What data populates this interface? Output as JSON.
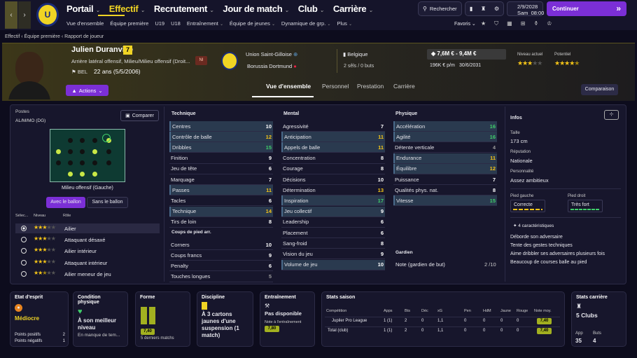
{
  "nav": {
    "items": [
      "Portail",
      "Effectif",
      "Recrutement",
      "Jour de match",
      "Club",
      "Carrière"
    ],
    "active": "Effectif",
    "subitems": [
      "Vue d'ensemble",
      "Équipe première",
      "U19",
      "U18",
      "Entraînement",
      "Équipe de jeunes",
      "Dynamique de grp.",
      "Plus"
    ],
    "search": "Rechercher",
    "date": "2/9/2028",
    "day_time": "Sam  08:00",
    "continue": "Continuer",
    "favoris": "Favoris"
  },
  "breadcrumb": [
    "Effectif",
    "Équipe première",
    "Rapport de joueur"
  ],
  "player": {
    "name": "Julien Duranville",
    "number": "7",
    "role": "Arrière latéral offensif, Milieu/Milieu offensif (Droit...",
    "nationality": "BEL",
    "age": "22 ans (5/5/2006)",
    "nl": "NI",
    "club": "Union Saint-Gilloise",
    "loan_club": "Borussia Dortmund",
    "country": "Belgique",
    "stats": "2 sêls / 0 buts",
    "value": "7,6M € - 9,4M €",
    "wage": "196K € p/m",
    "contract": "30/6/2031",
    "actions": "Actions",
    "current_label": "Niveau actuel",
    "potential_label": "Potentiel",
    "current_stars": 3,
    "potential_stars": 4.5
  },
  "tabs": [
    "Vue d'ensemble",
    "Personnel",
    "Prestation",
    "Carrière"
  ],
  "compare_btn": "Comparaison",
  "positions": {
    "title": "Postes",
    "value": "AL/M/MO (DG)",
    "compare": "Comparer",
    "caption": "Milieu offensif (Gauche)",
    "toggle": [
      "Avec le ballon",
      "Sans le ballon"
    ],
    "headers": [
      "Sélec...",
      "Niveau",
      "Rôle"
    ],
    "roles": [
      {
        "name": "Ailier",
        "stars": 3,
        "selected": true
      },
      {
        "name": "Attaquant désaxé",
        "stars": 3
      },
      {
        "name": "Ailier intérieur",
        "stars": 3
      },
      {
        "name": "Attaquant intérieur",
        "stars": 3
      },
      {
        "name": "Ailier meneur de jeu",
        "stars": 2.5
      }
    ]
  },
  "technique": {
    "title": "Technique",
    "rows": [
      [
        "Centres",
        "10"
      ],
      [
        "Contrôle de balle",
        "12"
      ],
      [
        "Dribbles",
        "15"
      ],
      [
        "Finition",
        "9"
      ],
      [
        "Jeu de tête",
        "6"
      ],
      [
        "Marquage",
        "7"
      ],
      [
        "Passes",
        "11"
      ],
      [
        "Tacles",
        "6"
      ],
      [
        "Technique",
        "14"
      ],
      [
        "Tirs de loin",
        "8"
      ]
    ],
    "set_title": "Coups de pied arr.",
    "set_rows": [
      [
        "Corners",
        "10"
      ],
      [
        "Coups francs",
        "9"
      ],
      [
        "Penalty",
        "6"
      ],
      [
        "Touches longues",
        "5"
      ]
    ]
  },
  "mental": {
    "title": "Mental",
    "rows": [
      [
        "Agressivité",
        "7"
      ],
      [
        "Anticipation",
        "11"
      ],
      [
        "Appels de balle",
        "11"
      ],
      [
        "Concentration",
        "8"
      ],
      [
        "Courage",
        "8"
      ],
      [
        "Décisions",
        "10"
      ],
      [
        "Détermination",
        "13"
      ],
      [
        "Inspiration",
        "17"
      ],
      [
        "Jeu collectif",
        "9"
      ],
      [
        "Leadership",
        "6"
      ],
      [
        "Placement",
        "6"
      ],
      [
        "Sang-froid",
        "8"
      ],
      [
        "Vision du jeu",
        "9"
      ],
      [
        "Volume de jeu",
        "10"
      ]
    ]
  },
  "physique": {
    "title": "Physique",
    "rows": [
      [
        "Accélération",
        "16"
      ],
      [
        "Agilité",
        "16"
      ],
      [
        "Détente verticale",
        "4"
      ],
      [
        "Endurance",
        "11"
      ],
      [
        "Équilibre",
        "12"
      ],
      [
        "Puissance",
        "7"
      ],
      [
        "Qualités phys. nat.",
        "8"
      ],
      [
        "Vitesse",
        "15"
      ]
    ],
    "gk_title": "Gardien",
    "gk_row": [
      "Note (gardien de but)",
      "2 /10"
    ]
  },
  "info": {
    "title": "Infos",
    "height_label": "Taille",
    "height": "173 cm",
    "rep_label": "Réputation",
    "rep": "Nationale",
    "pers_label": "Personnalité",
    "pers": "Assez ambitieux",
    "lf_label": "Pied gauche",
    "lf": "Correcte",
    "rf_label": "Pied droit",
    "rf": "Très fort",
    "traits_title": "4 caractéristiques",
    "traits": [
      "Déborde son adversaire",
      "Tente des gestes techniques",
      "Aime dribbler ses adversaires plusieurs fois",
      "Beaucoup de courses balle au pied"
    ]
  },
  "cards": {
    "esprit": {
      "title": "Etat d'esprit",
      "value": "Médiocre",
      "rows": [
        [
          "Points positifs",
          "2"
        ],
        [
          "Points négatifs",
          "1"
        ]
      ]
    },
    "condition": {
      "title": "Condition physique",
      "value": "À son meilleur niveau",
      "sub": "En manque de tem..."
    },
    "forme": {
      "title": "Forme",
      "rating": "7,40",
      "sub": "5 derniers matchs"
    },
    "discipline": {
      "title": "Discipline",
      "value": "À 3 cartons jaunes d'une suspension (1 match)"
    },
    "training": {
      "title": "Entraînement",
      "value": "Pas disponible",
      "sub": "Note à l'entraînement",
      "rating": "7,80"
    },
    "season": {
      "title": "Stats saison",
      "headers": [
        "Compétition",
        "Apps",
        "Bts",
        "Déc",
        "xG",
        "Pen",
        "HdM",
        "Jaune",
        "Rouge",
        "Note moy."
      ],
      "rows": [
        [
          "Jupiler Pro League",
          "1 (1)",
          "2",
          "0",
          "1,1",
          "0",
          "0",
          "0",
          "0",
          "7,40"
        ],
        [
          "Total (club)",
          "1 (1)",
          "2",
          "0",
          "1,1",
          "0",
          "0",
          "0",
          "0",
          "7,40"
        ]
      ]
    },
    "career": {
      "title": "Stats carrière",
      "value": "5 Clubs",
      "labels": [
        "App",
        "Buts"
      ],
      "values": [
        "35",
        "4"
      ]
    }
  }
}
